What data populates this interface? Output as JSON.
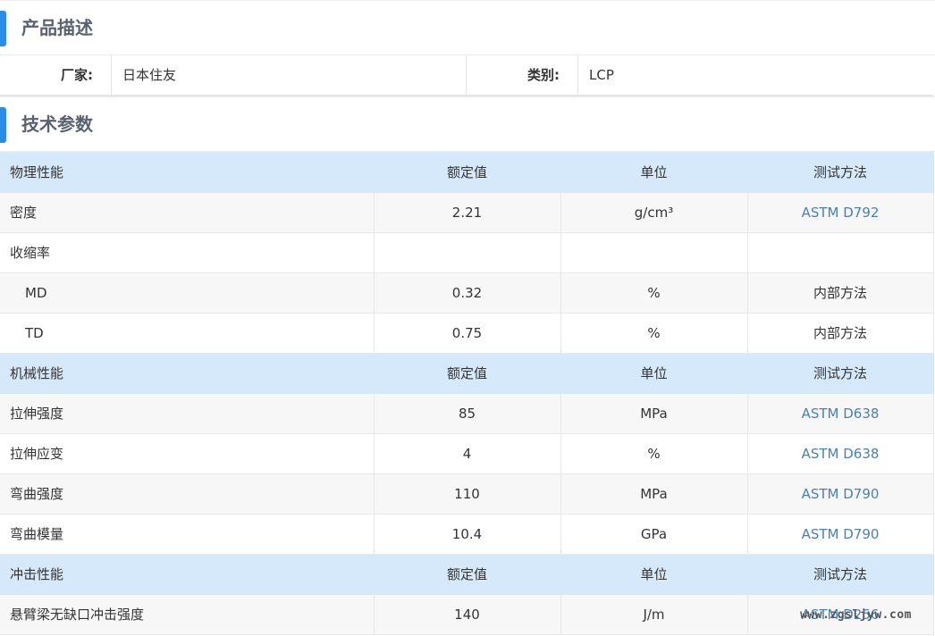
{
  "product_section": {
    "title": "产品描述"
  },
  "vendor": {
    "maker_label": "厂家:",
    "maker_value": "日本住友",
    "category_label": "类别:",
    "category_value": "LCP"
  },
  "tech_section": {
    "title": "技术参数"
  },
  "table": {
    "groups": [
      {
        "header": [
          "物理性能",
          "额定值",
          "单位",
          "测试方法"
        ],
        "rows": [
          {
            "name": "密度",
            "value": "2.21",
            "unit": "g/cm³",
            "method": "ASTM D792",
            "link": true,
            "sub": false
          },
          {
            "name": "收缩率",
            "value": "",
            "unit": "",
            "method": "",
            "link": false,
            "sub": false
          },
          {
            "name": "MD",
            "value": "0.32",
            "unit": "%",
            "method": "内部方法",
            "link": false,
            "sub": true
          },
          {
            "name": "TD",
            "value": "0.75",
            "unit": "%",
            "method": "内部方法",
            "link": false,
            "sub": true
          }
        ]
      },
      {
        "header": [
          "机械性能",
          "额定值",
          "单位",
          "测试方法"
        ],
        "rows": [
          {
            "name": "拉伸强度",
            "value": "85",
            "unit": "MPa",
            "method": "ASTM D638",
            "link": true,
            "sub": false
          },
          {
            "name": "拉伸应变",
            "value": "4",
            "unit": "%",
            "method": "ASTM D638",
            "link": true,
            "sub": false
          },
          {
            "name": "弯曲强度",
            "value": "110",
            "unit": "MPa",
            "method": "ASTM D790",
            "link": true,
            "sub": false
          },
          {
            "name": "弯曲模量",
            "value": "10.4",
            "unit": "GPa",
            "method": "ASTM D790",
            "link": true,
            "sub": false
          }
        ]
      },
      {
        "header": [
          "冲击性能",
          "额定值",
          "单位",
          "测试方法"
        ],
        "rows": [
          {
            "name": "悬臂梁无缺口冲击强度",
            "value": "140",
            "unit": "J/m",
            "method": "ASTM D256",
            "link": true,
            "sub": false
          }
        ]
      }
    ]
  },
  "watermark": "www.zgsljyw.com",
  "colors": {
    "accent": "#2a8be8",
    "group_bg": "#d6e9fb",
    "link": "#4a7fb5"
  }
}
